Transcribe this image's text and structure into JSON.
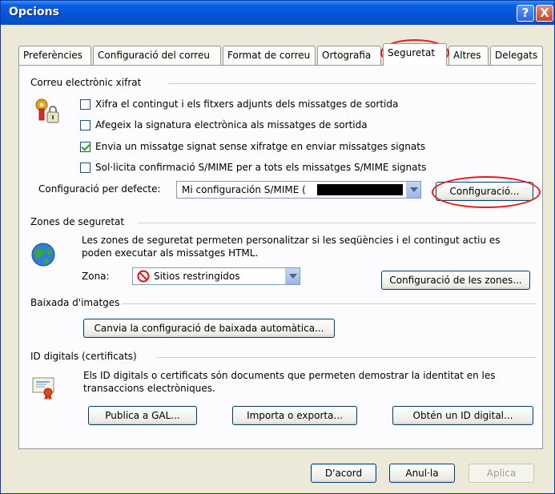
{
  "window": {
    "title": "Opcions"
  },
  "titlebar": {
    "help_symbol": "?",
    "close_symbol": "X"
  },
  "tabs": [
    {
      "label": "Preferències"
    },
    {
      "label": "Configuració del correu"
    },
    {
      "label": "Format de correu"
    },
    {
      "label": "Ortografia"
    },
    {
      "label": "Seguretat",
      "active": true
    },
    {
      "label": "Altres"
    },
    {
      "label": "Delegats"
    }
  ],
  "encrypted_mail": {
    "group_label": "Correu electrònic xifrat",
    "options": [
      {
        "label": "Xifra el contingut i els fitxers adjunts dels missatges de sortida",
        "checked": false
      },
      {
        "label": "Afegeix la signatura electrònica als missatges de sortida",
        "checked": false
      },
      {
        "label": "Envia un missatge signat sense xifratge en enviar missatges signats",
        "checked": true
      },
      {
        "label": "Sol·licita confirmació S/MIME per a tots els missatges S/MIME signats",
        "checked": false
      }
    ],
    "default_setting_label": "Configuració per defecte:",
    "default_setting_value": "Mi configuración S/MIME (",
    "settings_button": "Configuració..."
  },
  "security_zones": {
    "group_label": "Zones de seguretat",
    "description": "Les zones de seguretat permeten personalitzar si les seqüències i el contingut actiu es poden executar als missatges HTML.",
    "zone_label": "Zona:",
    "zone_value": "Sitios restringidos",
    "zone_settings_button": "Configuració de les zones..."
  },
  "image_download": {
    "group_label": "Baixada d'imatges",
    "change_button": "Canvia la configuració de baixada automàtica..."
  },
  "digital_ids": {
    "group_label": "ID digitals (certificats)",
    "description": "Els ID digitals o certificats són documents que permeten demostrar la identitat en les transaccions electròniques.",
    "publish_button": "Publica a GAL...",
    "import_export_button": "Importa o exporta...",
    "get_id_button": "Obtén un ID digital..."
  },
  "footer": {
    "ok_button": "D'acord",
    "cancel_button": "Anul·la",
    "apply_button": "Aplica"
  },
  "colors": {
    "annotation": "#e21b1b",
    "titlebar": "#0654d6"
  }
}
